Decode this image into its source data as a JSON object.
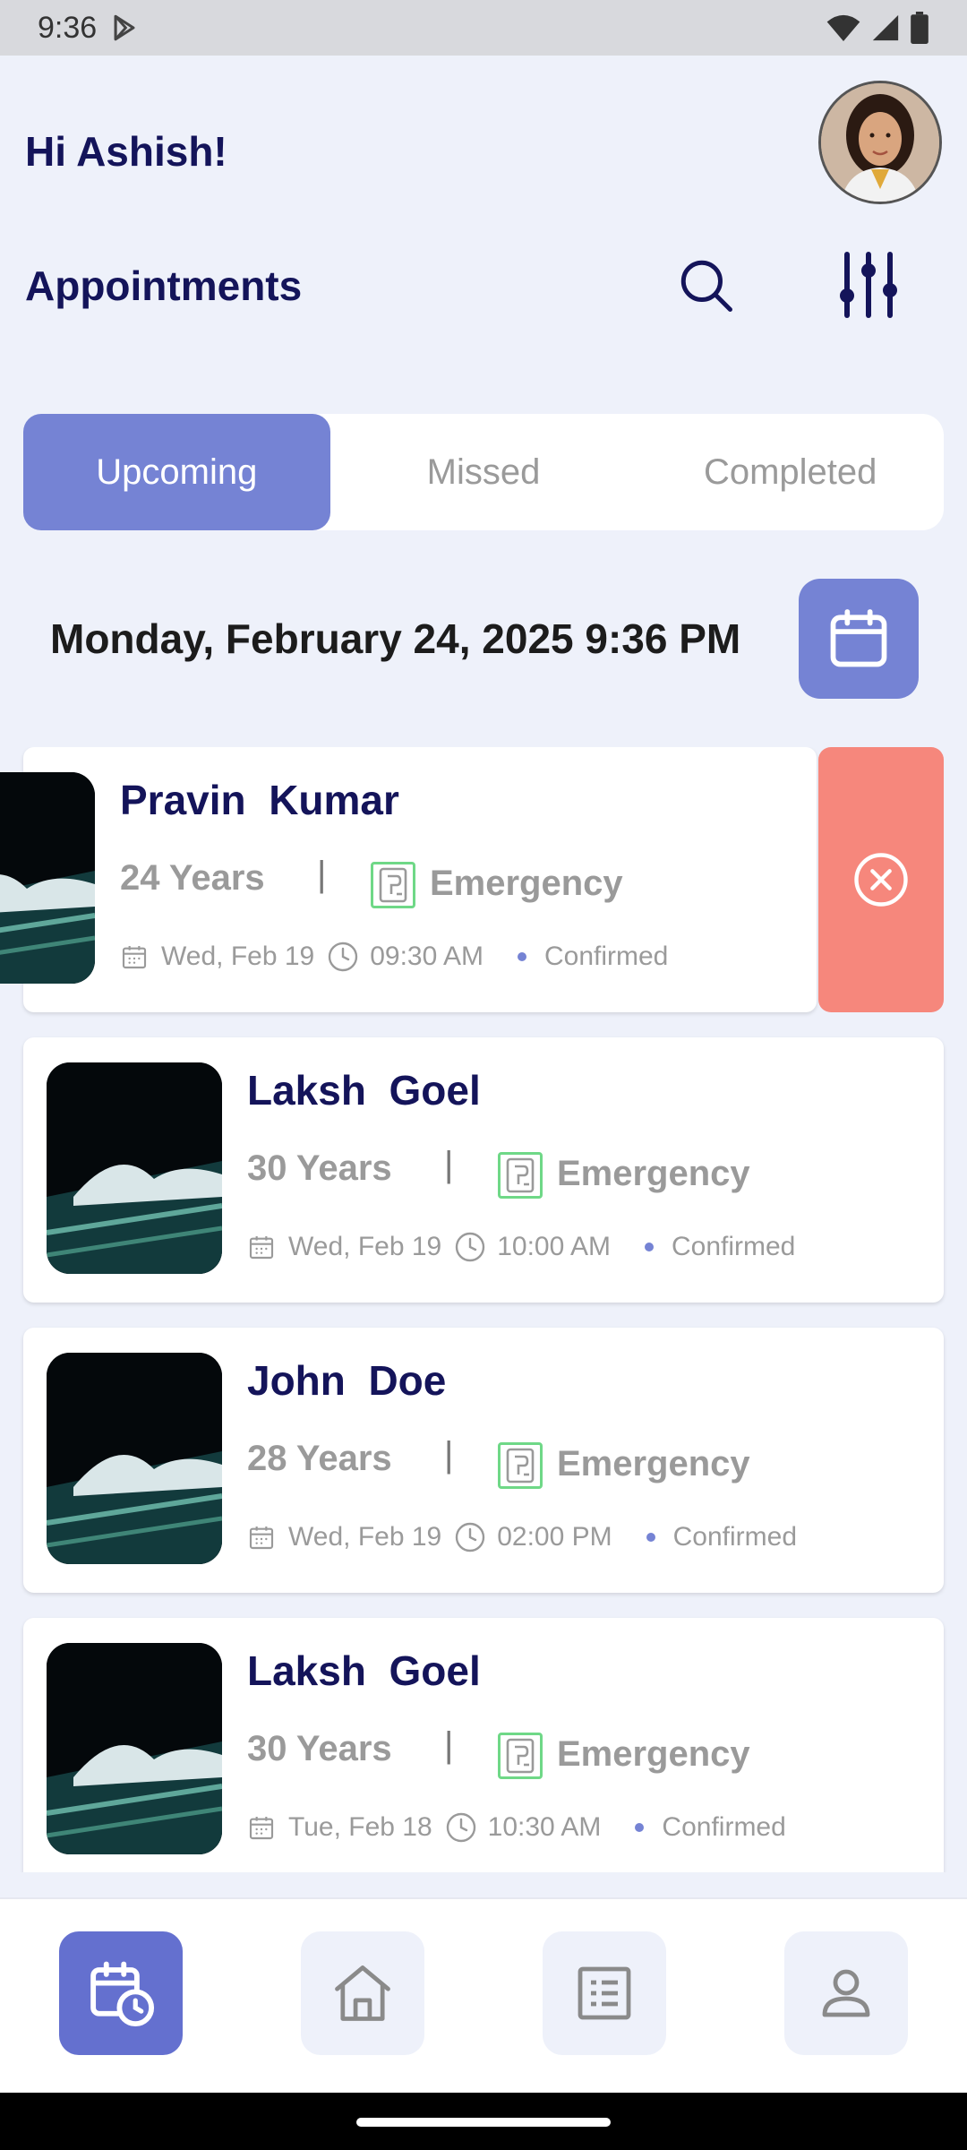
{
  "status_bar": {
    "time": "9:36"
  },
  "header": {
    "greeting": "Hi Ashish!",
    "section_title": "Appointments"
  },
  "tabs": [
    {
      "label": "Upcoming",
      "active": true
    },
    {
      "label": "Missed",
      "active": false
    },
    {
      "label": "Completed",
      "active": false
    }
  ],
  "current_datetime": "Monday, February 24, 2025 9:36 PM",
  "appointments": [
    {
      "name": "Pravin  Kumar",
      "age": "24 Years",
      "separator": "|",
      "type": "Emergency",
      "date": "Wed, Feb 19",
      "time": "09:30 AM",
      "status": "Confirmed"
    },
    {
      "name": "Laksh  Goel",
      "age": "30 Years",
      "separator": "|",
      "type": "Emergency",
      "date": "Wed, Feb 19",
      "time": "10:00 AM",
      "status": "Confirmed"
    },
    {
      "name": "John  Doe",
      "age": "28 Years",
      "separator": "|",
      "type": "Emergency",
      "date": "Wed, Feb 19",
      "time": "02:00 PM",
      "status": "Confirmed"
    },
    {
      "name": "Laksh  Goel",
      "age": "30 Years",
      "separator": "|",
      "type": "Emergency",
      "date": "Tue, Feb 18",
      "time": "10:30 AM",
      "status": "Confirmed"
    }
  ],
  "bottom_nav": [
    {
      "icon": "calendar-clock-icon",
      "active": true
    },
    {
      "icon": "home-icon",
      "active": false
    },
    {
      "icon": "list-icon",
      "active": false
    },
    {
      "icon": "profile-icon",
      "active": false
    }
  ],
  "colors": {
    "accent": "#7583d4",
    "nav_active": "#6470cf",
    "delete": "#f6877c",
    "heading": "#14145a",
    "emergency_border": "#6fd887"
  }
}
